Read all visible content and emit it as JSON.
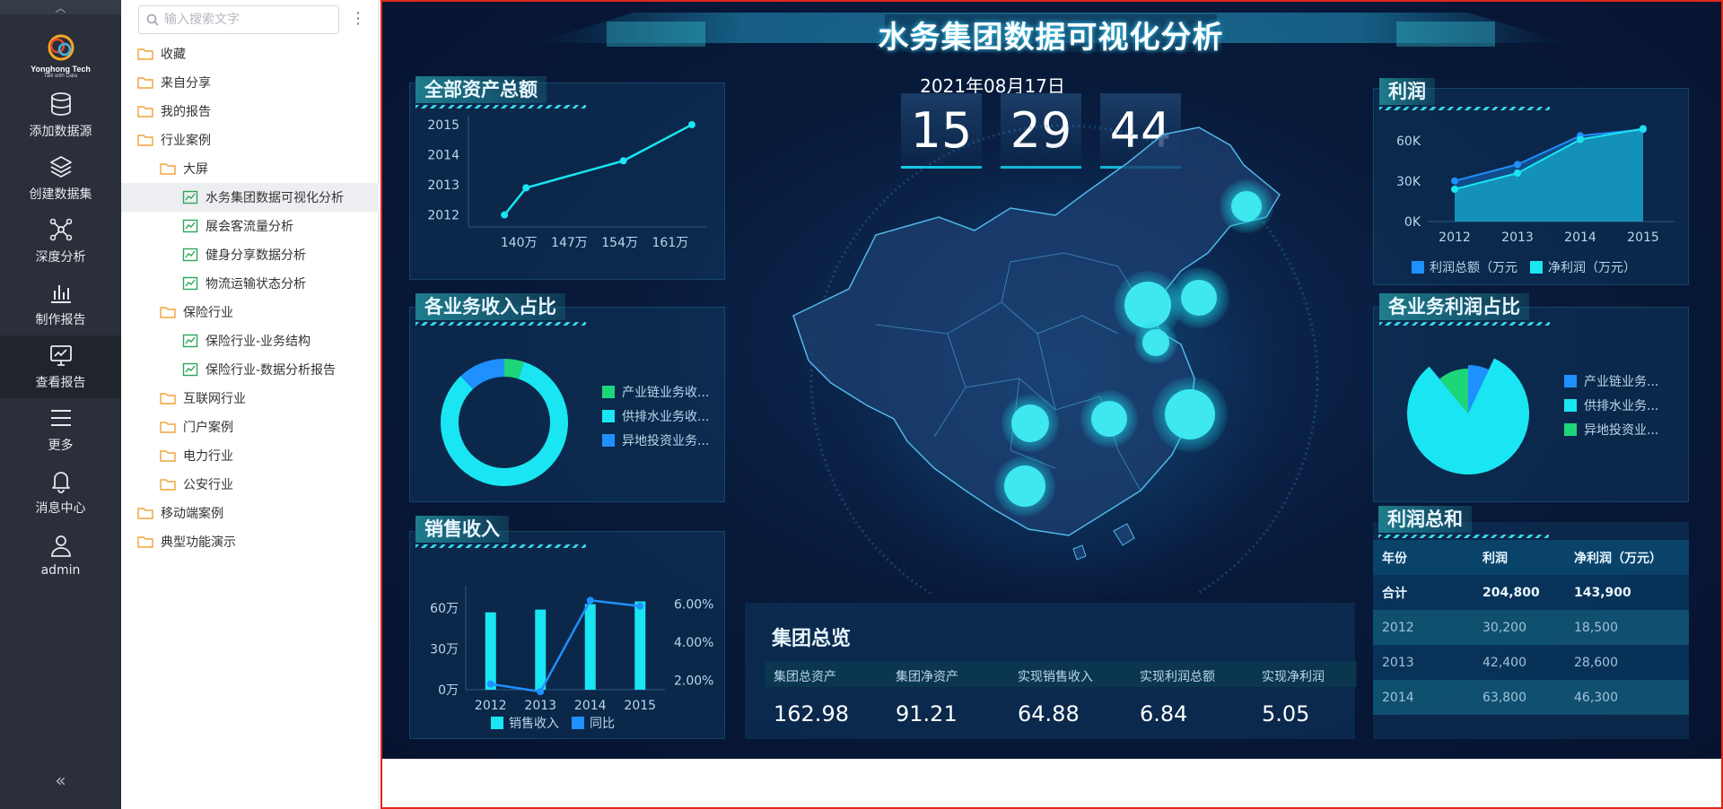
{
  "rail": {
    "brand": "Yonghong Tech",
    "slogan": "Talk with Data",
    "items": [
      {
        "label": "添加数据源",
        "icon": "database-icon"
      },
      {
        "label": "创建数据集",
        "icon": "layers-icon"
      },
      {
        "label": "深度分析",
        "icon": "network-icon"
      },
      {
        "label": "制作报告",
        "icon": "bar-chart-icon"
      },
      {
        "label": "查看报告",
        "icon": "monitor-chart-icon"
      },
      {
        "label": "更多",
        "icon": "menu-icon"
      },
      {
        "label": "消息中心",
        "icon": "bell-icon"
      },
      {
        "label": "admin",
        "icon": "user-icon"
      }
    ],
    "active_index": 4
  },
  "tree": {
    "search_placeholder": "输入搜索文字",
    "items": [
      {
        "label": "收藏",
        "type": "folder",
        "depth": 0
      },
      {
        "label": "来自分享",
        "type": "folder",
        "depth": 0
      },
      {
        "label": "我的报告",
        "type": "folder",
        "depth": 0
      },
      {
        "label": "行业案例",
        "type": "folder",
        "depth": 0
      },
      {
        "label": "大屏",
        "type": "folder",
        "depth": 1
      },
      {
        "label": "水务集团数据可视化分析",
        "type": "report",
        "depth": 2,
        "selected": true
      },
      {
        "label": "展会客流量分析",
        "type": "report",
        "depth": 2
      },
      {
        "label": "健身分享数据分析",
        "type": "report",
        "depth": 2
      },
      {
        "label": "物流运输状态分析",
        "type": "report",
        "depth": 2
      },
      {
        "label": "保险行业",
        "type": "folder",
        "depth": 1
      },
      {
        "label": "保险行业-业务结构",
        "type": "report",
        "depth": 2
      },
      {
        "label": "保险行业-数据分析报告",
        "type": "report",
        "depth": 2
      },
      {
        "label": "互联网行业",
        "type": "folder",
        "depth": 1
      },
      {
        "label": "门户案例",
        "type": "folder",
        "depth": 1
      },
      {
        "label": "电力行业",
        "type": "folder",
        "depth": 1
      },
      {
        "label": "公安行业",
        "type": "folder",
        "depth": 1
      },
      {
        "label": "移动端案例",
        "type": "folder",
        "depth": 0
      },
      {
        "label": "典型功能演示",
        "type": "folder",
        "depth": 0
      }
    ]
  },
  "dashboard": {
    "title": "水务集团数据可视化分析",
    "date": "2021年08月17日",
    "clock": [
      "15",
      "29",
      "44"
    ],
    "colors": {
      "cyan": "#19e6f2",
      "blue": "#1e90ff",
      "green": "#1ed67a",
      "accent": "#13c8e6"
    },
    "assets": {
      "title": "全部资产总额",
      "y_labels": [
        "2015",
        "2014",
        "2013",
        "2012"
      ],
      "x_labels": [
        "140万",
        "147万",
        "154万",
        "161万"
      ],
      "points": [
        [
          138,
          2012
        ],
        [
          141,
          2012.9
        ],
        [
          154.5,
          2013.8
        ],
        [
          164,
          2015
        ]
      ]
    },
    "revenue_share": {
      "title": "各业务收入占比",
      "legend": [
        "产业链业务收...",
        "供排水业务收...",
        "异地投资业务..."
      ],
      "values": [
        0.05,
        0.83,
        0.12
      ]
    },
    "sales": {
      "title": "销售收入",
      "y_left": [
        "60万",
        "30万",
        "0万"
      ],
      "y_right": [
        "6.00%",
        "4.00%",
        "2.00%"
      ],
      "categories": [
        "2012",
        "2013",
        "2014",
        "2015"
      ],
      "bars": [
        57,
        59,
        63,
        65
      ],
      "line": [
        1.8,
        1.4,
        6.2,
        5.9
      ],
      "legend": [
        "销售收入",
        "同比"
      ]
    },
    "profit": {
      "title": "利润",
      "y_labels": [
        "60K",
        "30K",
        "0K"
      ],
      "categories": [
        "2012",
        "2013",
        "2014",
        "2015"
      ],
      "series": [
        {
          "name": "利润总额（万元",
          "values": [
            30200,
            42400,
            63800,
            68400
          ]
        },
        {
          "name": "净利润（万元）",
          "values": [
            24000,
            36000,
            61000,
            69000
          ]
        }
      ]
    },
    "profit_share": {
      "title": "各业务利润占比",
      "legend": [
        "产业链业务...",
        "供排水业务...",
        "异地投资业..."
      ],
      "values": [
        0.07,
        0.82,
        0.11
      ]
    },
    "overview": {
      "title": "集团总览",
      "columns": [
        "集团总资产",
        "集团净资产",
        "实现销售收入",
        "实现利润总额",
        "实现净利润"
      ],
      "values": [
        "162.98",
        "91.21",
        "64.88",
        "6.84",
        "5.05"
      ]
    },
    "profit_table": {
      "title": "利润总和",
      "headers": [
        "年份",
        "利润",
        "净利润（万元）"
      ],
      "rows": [
        [
          "合计",
          "204,800",
          "143,900"
        ],
        [
          "2012",
          "30,200",
          "18,500"
        ],
        [
          "2013",
          "42,400",
          "28,600"
        ],
        [
          "2014",
          "63,800",
          "46,300"
        ]
      ]
    }
  }
}
